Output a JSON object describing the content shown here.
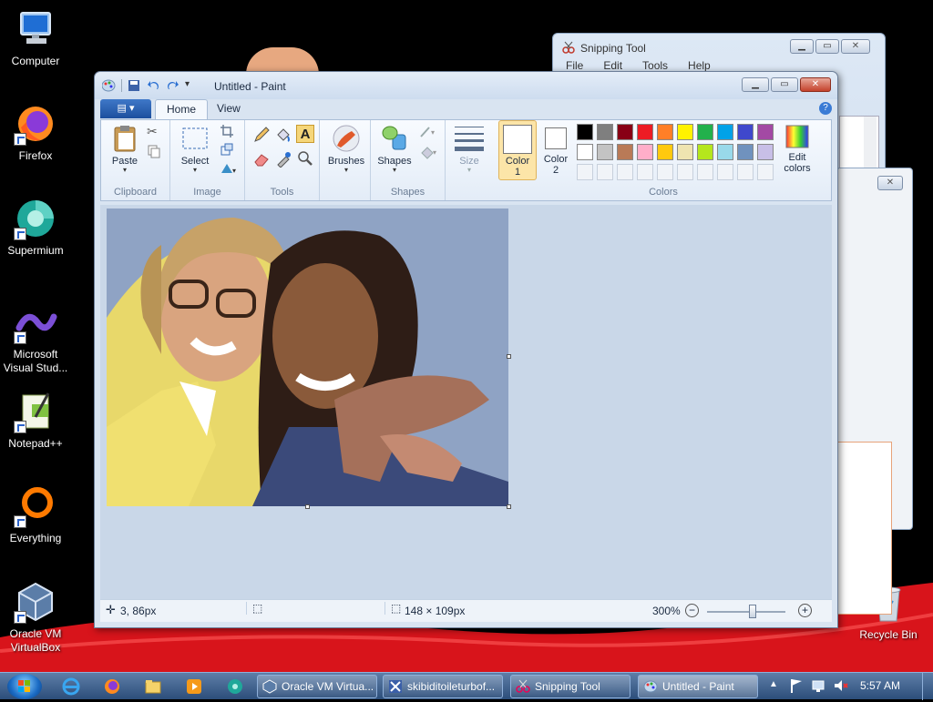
{
  "desktop": {
    "icons": [
      {
        "label": "Computer"
      },
      {
        "label": "Firefox"
      },
      {
        "label": "Supermium"
      },
      {
        "label": "Microsoft Visual Stud..."
      },
      {
        "label": "Notepad++"
      },
      {
        "label": "Everything"
      },
      {
        "label": "Oracle VM VirtualBox"
      },
      {
        "label": "Recycle Bin"
      }
    ]
  },
  "snipping": {
    "title": "Snipping Tool",
    "menu": [
      "File",
      "Edit",
      "Tools",
      "Help"
    ]
  },
  "paint": {
    "title": "Untitled - Paint",
    "file_label": "▤ ▾",
    "tabs": [
      "Home",
      "View"
    ],
    "groups": {
      "clipboard": "Clipboard",
      "image": "Image",
      "tools": "Tools",
      "shapes": "Shapes",
      "colors": "Colors"
    },
    "buttons": {
      "paste": "Paste",
      "select": "Select",
      "brushes": "Brushes",
      "shapes": "Shapes",
      "size": "Size",
      "color1": "Color 1",
      "color2": "Color 2",
      "edit_colors": "Edit colors"
    },
    "palette_row1": [
      "#000000",
      "#7f7f7f",
      "#880015",
      "#ed1c24",
      "#ff7f27",
      "#fff200",
      "#22b14c",
      "#00a2e8",
      "#3f48cc",
      "#a349a4"
    ],
    "palette_row2": [
      "#ffffff",
      "#c3c3c3",
      "#b97a57",
      "#ffaec9",
      "#ffc90e",
      "#efe4b0",
      "#b5e61d",
      "#99d9ea",
      "#7092be",
      "#c8bfe7"
    ],
    "color1": "#ffffff",
    "color2": "#ffffff",
    "status": {
      "cursor_pos": "3, 86px",
      "image_size": "148 × 109px",
      "zoom": "300%"
    },
    "zoom_level": 0.58
  },
  "taskbar": {
    "buttons": [
      {
        "label": "Oracle VM Virtua..."
      },
      {
        "label": "skibiditoileturbof..."
      },
      {
        "label": "Snipping Tool"
      },
      {
        "label": "Untitled - Paint"
      }
    ],
    "clock": "5:57 AM"
  }
}
